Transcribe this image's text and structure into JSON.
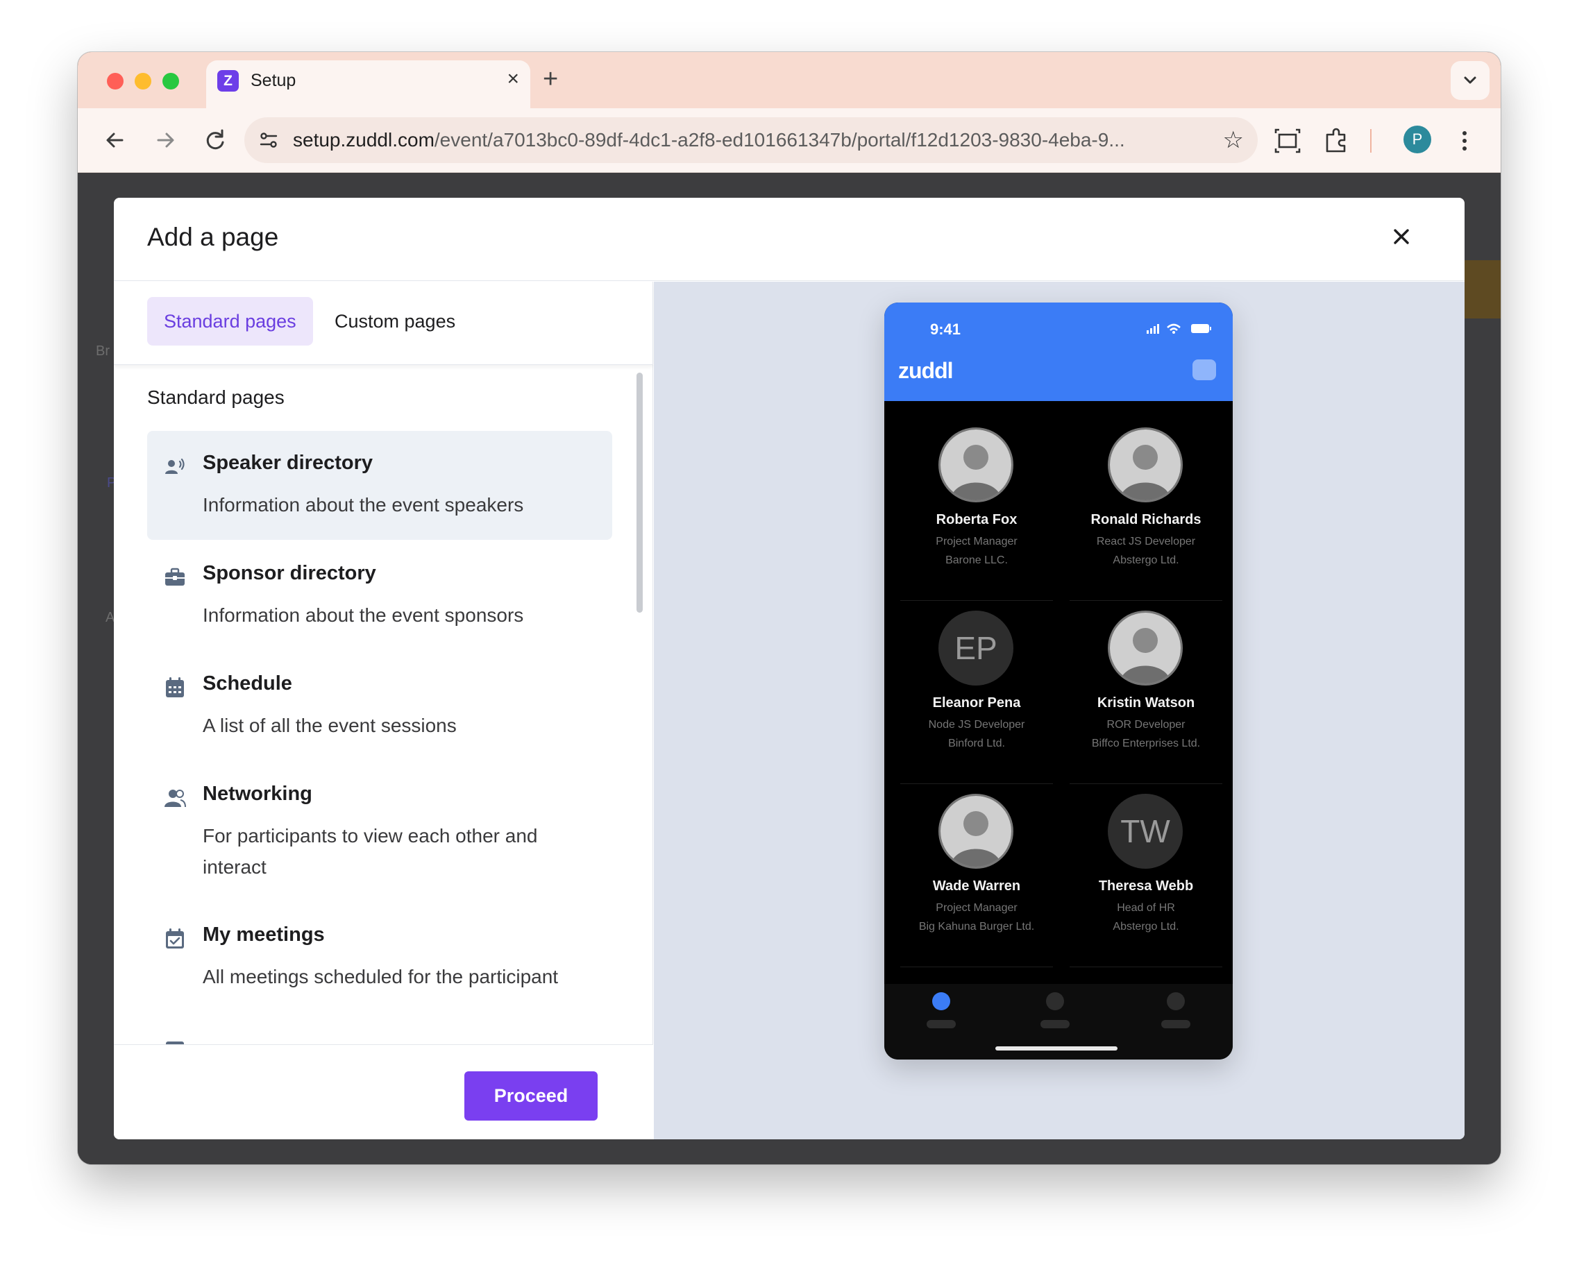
{
  "browser": {
    "tab_title": "Setup",
    "tab_favicon_letter": "Z",
    "new_tab": "+",
    "close_tab": "×",
    "url_host": "setup.zuddl.com",
    "url_path": "/event/a7013bc0-89df-4dc1-a2f8-ed101661347b/portal/f12d1203-9830-4eba-9...",
    "profile_initial": "P",
    "traffic_light_colors": [
      "#ff5f57",
      "#febc2e",
      "#28c840"
    ]
  },
  "background_page": {
    "fragments": [
      "Br",
      "P",
      "A"
    ]
  },
  "modal": {
    "title": "Add a page",
    "tabs": [
      {
        "label": "Standard pages",
        "active": true
      },
      {
        "label": "Custom pages",
        "active": false
      }
    ],
    "section_title": "Standard pages",
    "items": [
      {
        "title": "Speaker directory",
        "description": "Information about the event speakers",
        "icon": "speaker-icon",
        "selected": true
      },
      {
        "title": "Sponsor directory",
        "description": "Information about the event sponsors",
        "icon": "briefcase-icon",
        "selected": false
      },
      {
        "title": "Schedule",
        "description": "A list of all the event sessions",
        "icon": "calendar-icon",
        "selected": false
      },
      {
        "title": "Networking",
        "description": "For participants to view each other and interact",
        "icon": "people-icon",
        "selected": false
      },
      {
        "title": "My meetings",
        "description": "All meetings scheduled for the participant",
        "icon": "calendar-check-icon",
        "selected": false
      }
    ],
    "proceed_label": "Proceed",
    "accent_color": "#7a3ff0"
  },
  "preview": {
    "time": "9:41",
    "brand": "zuddl",
    "header_color": "#3b7cf6",
    "speakers": [
      {
        "name": "Roberta Fox",
        "role": "Project Manager",
        "company": "Barone LLC.",
        "initials": ""
      },
      {
        "name": "Ronald Richards",
        "role": "React JS Developer",
        "company": "Abstergo Ltd.",
        "initials": ""
      },
      {
        "name": "Eleanor Pena",
        "role": "Node JS Developer",
        "company": "Binford Ltd.",
        "initials": "EP"
      },
      {
        "name": "Kristin Watson",
        "role": "ROR Developer",
        "company": "Biffco Enterprises Ltd.",
        "initials": ""
      },
      {
        "name": "Wade Warren",
        "role": "Project Manager",
        "company": "Big Kahuna Burger Ltd.",
        "initials": ""
      },
      {
        "name": "Theresa Webb",
        "role": "Head of HR",
        "company": "Abstergo Ltd.",
        "initials": "TW"
      }
    ]
  }
}
